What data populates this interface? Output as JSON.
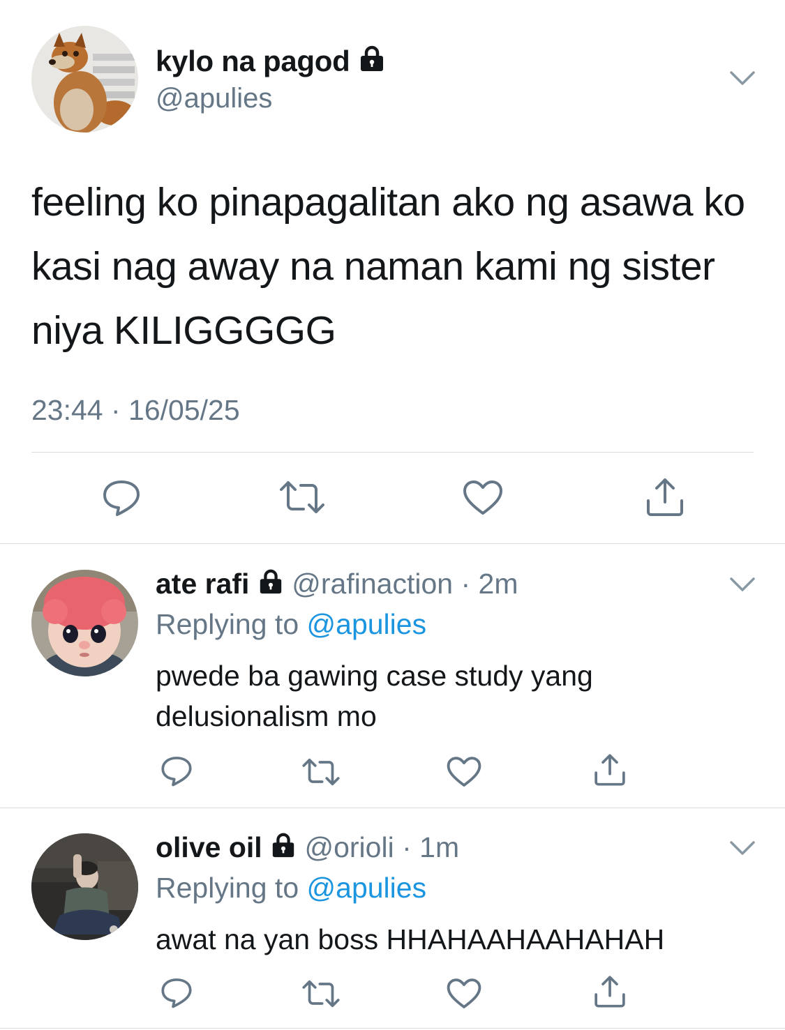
{
  "main_tweet": {
    "display_name": "kylo na pagod",
    "handle": "@apulies",
    "text": "feeling ko pinapagalitan ako ng asawa ko kasi nag away na naman kami ng sister niya KILIGGGGG",
    "timestamp": "23:44 · 16/05/25"
  },
  "replies": [
    {
      "display_name": "ate rafi",
      "handle": "@rafinaction",
      "time": "· 2m",
      "replying_label": "Replying to",
      "replying_to": "@apulies",
      "text": "pwede ba gawing case study yang delusionalism mo"
    },
    {
      "display_name": "olive oil",
      "handle": "@orioli",
      "time": "· 1m",
      "replying_label": "Replying to",
      "replying_to": "@apulies",
      "text": "awat na yan boss HHAHAAHAAHAHAH"
    }
  ],
  "icons": [
    "lock-icon",
    "chevron-down-icon",
    "reply-icon",
    "retweet-icon",
    "like-icon",
    "share-icon"
  ],
  "colors": {
    "text": "#14171a",
    "secondary": "#657786",
    "link": "#1b95e0",
    "divider": "#d8dde1"
  }
}
